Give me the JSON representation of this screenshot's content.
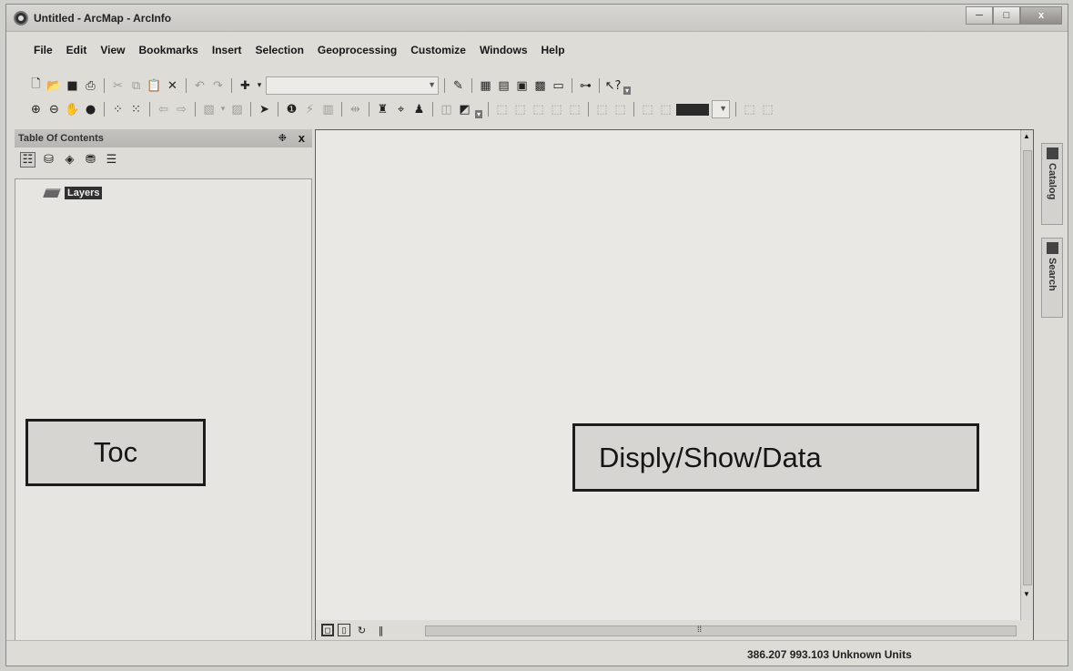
{
  "window": {
    "title": "Untitled - ArcMap - ArcInfo",
    "controls": [
      "─",
      "□",
      "x"
    ]
  },
  "menubar": {
    "items": [
      "File",
      "Edit",
      "View",
      "Bookmarks",
      "Insert",
      "Selection",
      "Geoprocessing",
      "Customize",
      "Windows",
      "Help"
    ]
  },
  "toolbar": {
    "scale_value": "",
    "color_value": ""
  },
  "toc": {
    "title": "Table Of Contents",
    "pin": "❉",
    "close": "x",
    "root_layer": "Layers",
    "annotation": "Toc"
  },
  "display": {
    "annotation": "Disply/Show/Data"
  },
  "dock_tabs": {
    "catalog": "Catalog",
    "search": "Search"
  },
  "status": {
    "coordinates": "386.207  993.103 Unknown Units"
  },
  "icons": [
    "new-document-icon",
    "open-icon",
    "save-icon",
    "print-icon",
    "cut-icon",
    "copy-icon",
    "paste-icon",
    "delete-icon",
    "undo-icon",
    "redo-icon",
    "add-data-icon",
    "editor-icon",
    "table-icon",
    "catalog-window-icon",
    "search-window-icon",
    "python-icon",
    "modelbuilder-icon",
    "whats-this-icon",
    "zoom-in-icon",
    "zoom-out-icon",
    "pan-icon",
    "full-extent-icon",
    "fixed-zoom-in-icon",
    "fixed-zoom-out-icon",
    "back-extent-icon",
    "forward-extent-icon",
    "select-features-icon",
    "clear-selection-icon",
    "select-elements-icon",
    "identify-icon",
    "find-icon",
    "go-to-xy-icon",
    "measure-icon",
    "hyperlink-icon",
    "html-popup-icon",
    "time-slider-icon"
  ]
}
